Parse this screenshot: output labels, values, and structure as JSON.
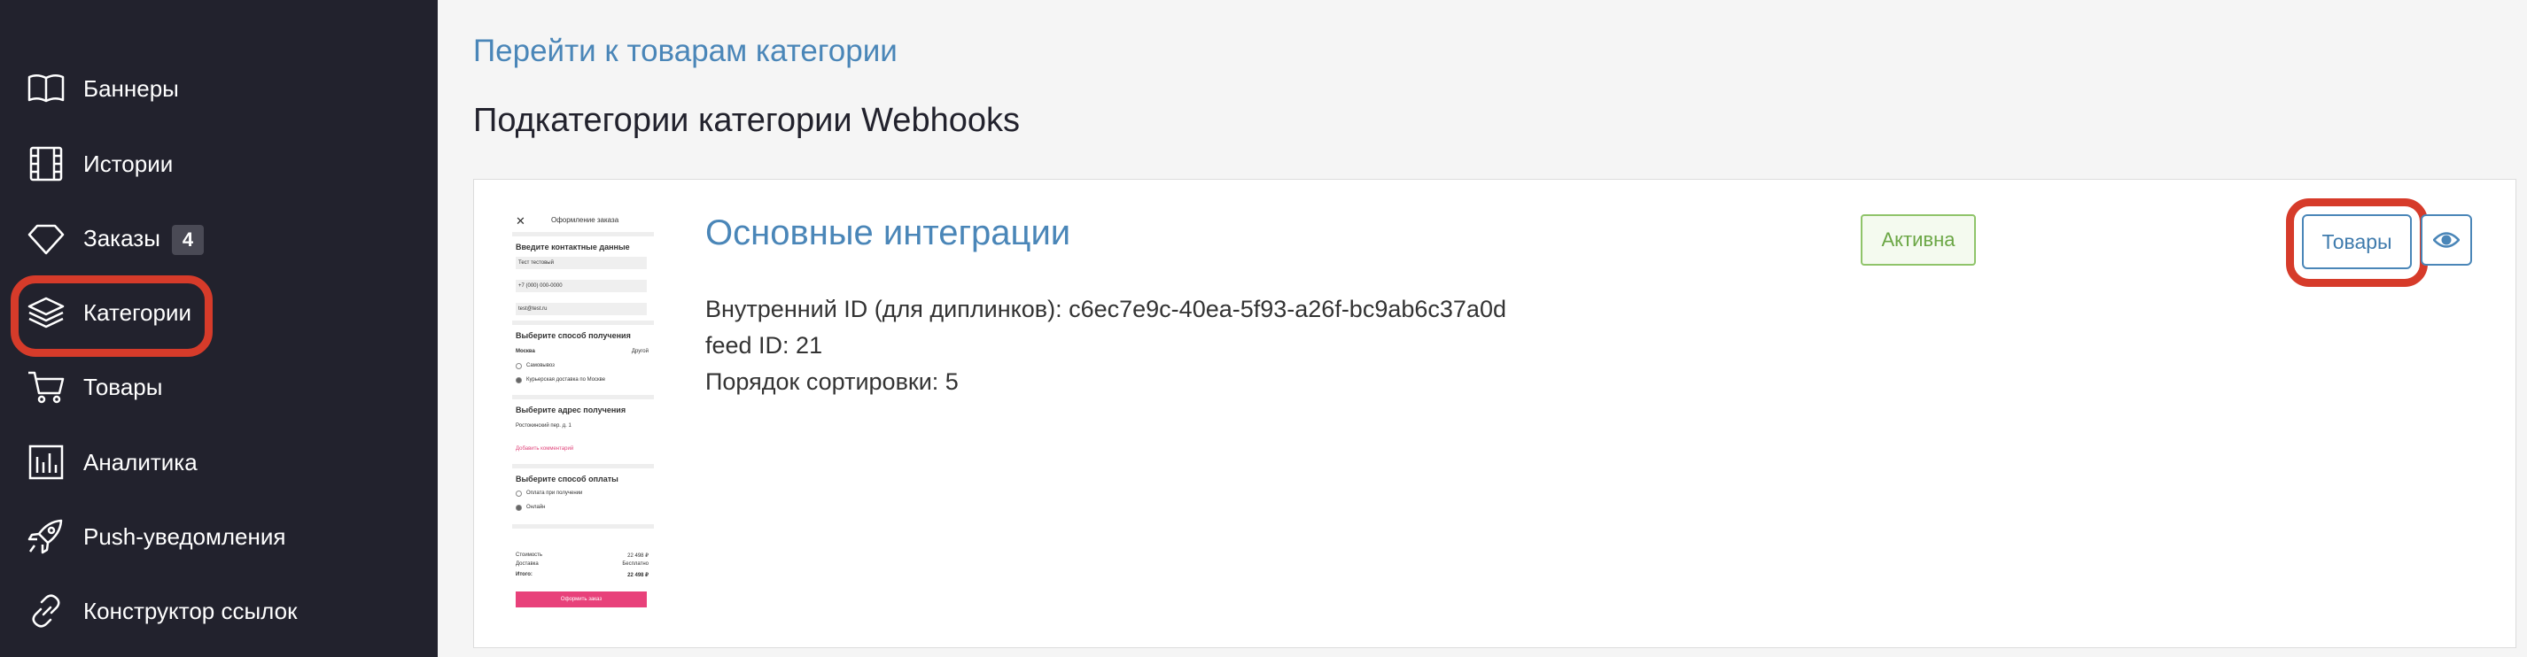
{
  "sidebar": {
    "items": [
      {
        "label": "Баннеры",
        "icon": "book-icon"
      },
      {
        "label": "Истории",
        "icon": "film-icon"
      },
      {
        "label": "Заказы",
        "icon": "diamond-icon",
        "badge": "4"
      },
      {
        "label": "Категории",
        "icon": "layers-icon"
      },
      {
        "label": "Товары",
        "icon": "cart-icon"
      },
      {
        "label": "Аналитика",
        "icon": "bar-chart-icon"
      },
      {
        "label": "Push-уведомления",
        "icon": "rocket-icon"
      },
      {
        "label": "Конструктор ссылок",
        "icon": "link-icon"
      }
    ]
  },
  "main": {
    "back_link": "Перейти к товарам категории",
    "title": "Подкатегории категории Webhooks"
  },
  "card": {
    "title": "Основные интеграции",
    "internal_id": "Внутренний ID (для диплинков): c6ec7e9c-40ea-5f93-a26f-bc9ab6c37a0d",
    "feed_id": "feed ID: 21",
    "sort_order": "Порядок сортировки: 5",
    "status": "Активна",
    "goods_button": "Товары",
    "view_icon": "eye-icon"
  },
  "thumbnail": {
    "header": "Оформление заказа",
    "contact_heading": "Введите контактные данные",
    "contact_fields": [
      "Тест тестовый",
      "+7 (000) 000-0000",
      "test@test.ru"
    ],
    "delivery_heading": "Выберите способ получения",
    "city": "Москва",
    "city_action": "Другой",
    "delivery_options": [
      "Самовывоз",
      "Курьерская доставка по Москве"
    ],
    "address_heading": "Выберите адрес получения",
    "address": "Ростокинский пер. д. 1",
    "add_comment": "Добавить комментарий",
    "payment_heading": "Выберите способ оплаты",
    "payment_options": [
      "Оплата при получении",
      "Онлайн"
    ],
    "cost_label": "Стоимость",
    "cost_value": "22 498 ₽",
    "delivery_label": "Доставка",
    "delivery_value": "Бесплатно",
    "total_label": "Итого:",
    "total_value": "22 498 ₽",
    "submit": "Оформить заказ"
  },
  "colors": {
    "sidebar_bg": "#22222d",
    "accent": "#4a86b8",
    "highlight": "#d63b2a",
    "active_status": "#6aa644"
  }
}
